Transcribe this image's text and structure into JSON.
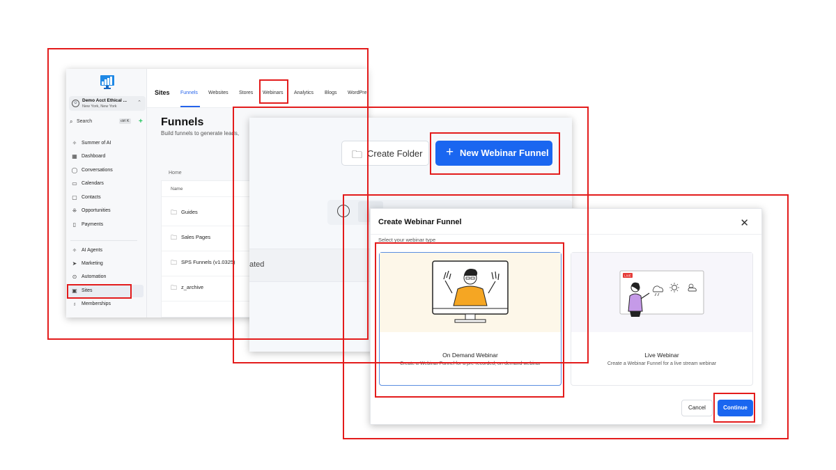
{
  "colors": {
    "highlight": "#e31b1b",
    "primary": "#1a66f0",
    "success": "#22c55e"
  },
  "app": {
    "account": {
      "name": "Demo Acct Ethical ...",
      "location": "New York, New York"
    },
    "search": {
      "label": "Search",
      "shortcut": "ctrl K"
    },
    "nav": [
      {
        "label": "Summer of AI",
        "icon": "sparkle-icon"
      },
      {
        "label": "Dashboard",
        "icon": "grid-icon"
      },
      {
        "label": "Conversations",
        "icon": "chat-icon"
      },
      {
        "label": "Calendars",
        "icon": "calendar-icon"
      },
      {
        "label": "Contacts",
        "icon": "contacts-icon"
      },
      {
        "label": "Opportunities",
        "icon": "opportunities-icon"
      },
      {
        "label": "Payments",
        "icon": "payments-icon"
      },
      {
        "label": "AI Agents",
        "icon": "sparkle-icon"
      },
      {
        "label": "Marketing",
        "icon": "send-icon"
      },
      {
        "label": "Automation",
        "icon": "automation-icon"
      },
      {
        "label": "Sites",
        "icon": "sites-icon"
      },
      {
        "label": "Memberships",
        "icon": "membership-icon"
      }
    ],
    "header": {
      "section": "Sites",
      "tabs": [
        "Funnels",
        "Websites",
        "Stores",
        "Webinars",
        "Analytics",
        "Blogs",
        "WordPre"
      ]
    },
    "page": {
      "title": "Funnels",
      "subtitle": "Build funnels to generate leads,",
      "breadcrumb": "Home",
      "column_name": "Name",
      "folders": [
        "Guides",
        "Sales Pages",
        "SPS Funnels (v1.0325)",
        "z_archive"
      ]
    }
  },
  "actions": {
    "create_folder": "Create Folder",
    "new_webinar_funnel": "New Webinar Funnel",
    "row_text": "ated"
  },
  "modal": {
    "title": "Create Webinar Funnel",
    "subtitle": "Select your webinar type",
    "options": [
      {
        "title": "On Demand Webinar",
        "description": "Create a Webinar Funnel for a pre-recorded, on-demand webinar"
      },
      {
        "title": "Live Webinar",
        "description": "Create a Webinar Funnel for a live stream webinar",
        "badge": "LIVE"
      }
    ],
    "cancel": "Cancel",
    "continue": "Continue"
  }
}
